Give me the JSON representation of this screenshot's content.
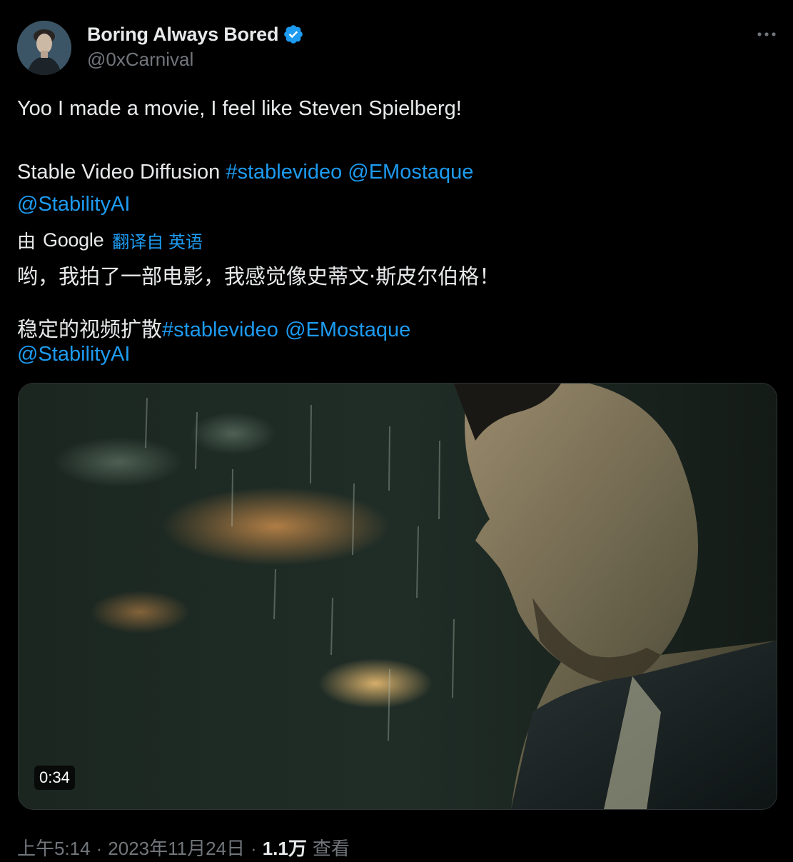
{
  "author": {
    "display_name": "Boring Always Bored",
    "handle": "@0xCarnival",
    "verified": true
  },
  "tweet": {
    "line1": "Yoo I made a movie, I feel like Steven Spielberg!",
    "line2_text": "Stable Video Diffusion ",
    "hashtag": "#stablevideo",
    "mention1": "@EMostaque",
    "mention2": "@StabilityAI"
  },
  "translation": {
    "by_label": "由",
    "provider": "Google",
    "translated_from": "翻译自 英语",
    "line1": "哟，我拍了一部电影，我感觉像史蒂文·斯皮尔伯格！",
    "line2_text": "稳定的视频扩散",
    "hashtag": "#stablevideo",
    "mention1": "@EMostaque",
    "mention2": "@StabilityAI"
  },
  "media": {
    "duration": "0:34"
  },
  "meta": {
    "time": "上午5:14",
    "date": "2023年11月24日",
    "separator": "·",
    "views_count": "1.1万",
    "views_label": "查看"
  },
  "colors": {
    "background": "#000000",
    "text": "#e7e9ea",
    "secondary": "#71767b",
    "link": "#1d9bf0"
  }
}
